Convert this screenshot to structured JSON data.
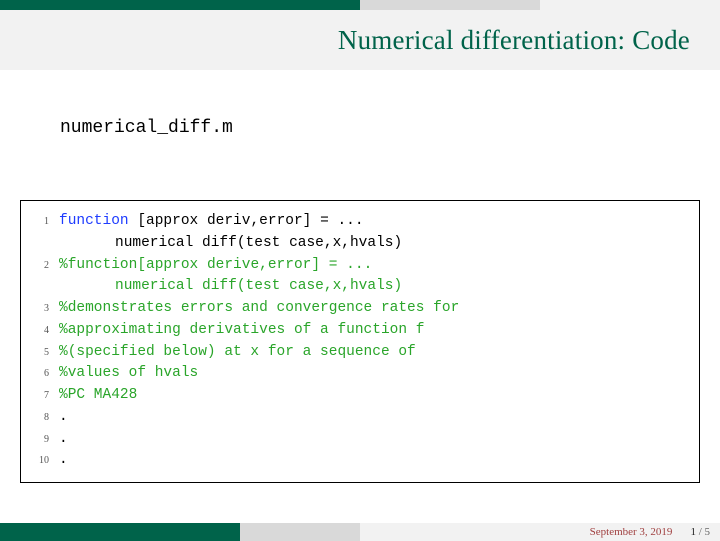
{
  "header": {
    "title": "Numerical differentiation: Code"
  },
  "filename": "numerical_diff.m",
  "code": {
    "lines": [
      {
        "n": "1",
        "kw": "function",
        "plain1": " [approx",
        "plain2": "deriv,error] = ..."
      },
      {
        "cont": true,
        "plain": "numerical",
        "plain2": "diff(test",
        "plain3": "case,x,hvals)"
      },
      {
        "n": "2",
        "cmt1": "%function[approx",
        "cmt2": "derive,error] = ..."
      },
      {
        "cont": true,
        "cmt1": "numerical",
        "cmt2": "diff(test",
        "cmt3": "case,x,hvals)"
      },
      {
        "n": "3",
        "cmt": "%demonstrates errors and convergence rates for"
      },
      {
        "n": "4",
        "cmt": "%approximating derivatives of a function f"
      },
      {
        "n": "5",
        "cmt": "%(specified below) at x for a sequence of"
      },
      {
        "n": "6",
        "cmt": "%values of hvals"
      },
      {
        "n": "7",
        "cmt": "%PC MA428"
      },
      {
        "n": "8",
        "plain": "."
      },
      {
        "n": "9",
        "plain": "."
      },
      {
        "n": "10",
        "plain": "."
      }
    ]
  },
  "footer": {
    "date": "September 3, 2019",
    "page_current": "1",
    "page_sep": " / ",
    "page_total": "5"
  }
}
